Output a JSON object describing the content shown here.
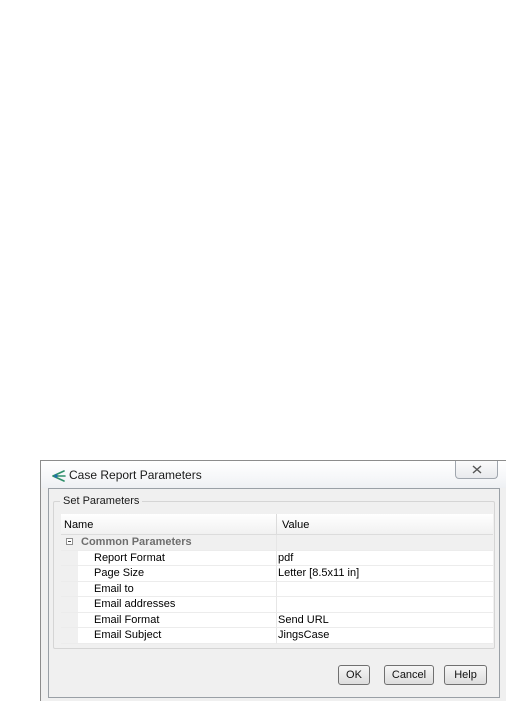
{
  "window": {
    "title": "Case Report Parameters",
    "close_icon": "close-icon"
  },
  "group": {
    "label": "Set Parameters"
  },
  "grid": {
    "columns": [
      "Name",
      "Value"
    ],
    "category": "Common Parameters",
    "rows": [
      {
        "name": "Report Format",
        "value": "pdf"
      },
      {
        "name": "Page Size",
        "value": "Letter [8.5x11 in]"
      },
      {
        "name": "Email to",
        "value": ""
      },
      {
        "name": "Email addresses",
        "value": ""
      },
      {
        "name": "Email Format",
        "value": "Send URL"
      },
      {
        "name": "Email Subject",
        "value": "JingsCase"
      }
    ]
  },
  "buttons": {
    "ok": "OK",
    "cancel": "Cancel",
    "help": "Help"
  },
  "colors": {
    "icon_accent": "#2f8f6a"
  }
}
